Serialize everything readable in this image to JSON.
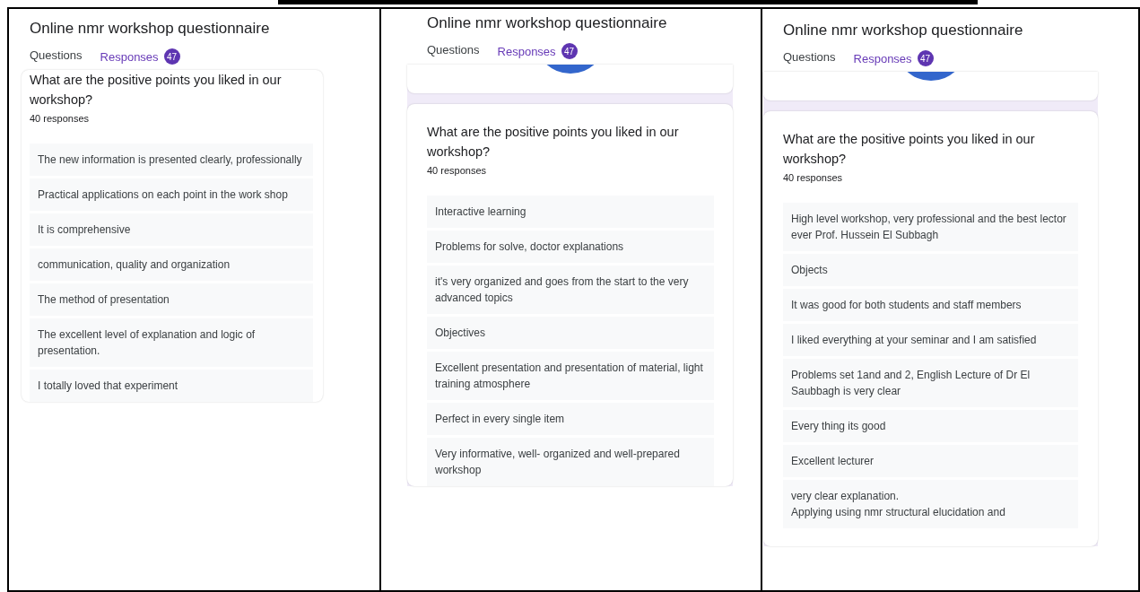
{
  "panels": [
    {
      "title": "Online nmr workshop questionnaire",
      "tabs": [
        {
          "label": "Questions",
          "selected": false
        },
        {
          "label": "Responses",
          "selected": true,
          "badge": "47"
        }
      ],
      "top_card": false,
      "question": "What are the positive points you liked in our workshop?",
      "count": "40 responses",
      "answers": [
        "The new information is presented clearly, professionally",
        "Practical applications on each point in the work shop",
        "It is comprehensive",
        "communication, quality and organization",
        "The method of presentation",
        "The excellent level of explanation and logic of presentation.",
        "I totally loved that experiment"
      ]
    },
    {
      "title": "Online nmr workshop questionnaire",
      "tabs": [
        {
          "label": "Questions",
          "selected": false
        },
        {
          "label": "Responses",
          "selected": true,
          "badge": "47"
        }
      ],
      "top_card": true,
      "question": "What are the positive points you liked in our workshop?",
      "count": "40 responses",
      "answers": [
        "Interactive learning",
        "Problems for solve, doctor explanations",
        "it's very organized and goes from the start to the very advanced topics",
        "Objectives",
        "Excellent presentation and presentation of material, light training atmosphere",
        "Perfect in every single item",
        "Very informative, well- organized and well-prepared workshop"
      ]
    },
    {
      "title": "Online nmr workshop questionnaire",
      "tabs": [
        {
          "label": "Questions",
          "selected": false
        },
        {
          "label": "Responses",
          "selected": true,
          "badge": "47"
        }
      ],
      "top_card": true,
      "question": "What are the positive points you liked in our workshop?",
      "count": "40 responses",
      "answers": [
        "High level workshop, very professional and the best lector ever Prof. Hussein El Subbagh",
        "Objects",
        "It was good for both students and staff members",
        "I liked everything at your seminar and I am satisfied",
        "Problems set 1and and 2, English Lecture of Dr El Saubbagh is very clear",
        "Every thing its good",
        "Excellent lecturer",
        "very clear explanation.\nApplying using nmr structural elucidation and"
      ]
    }
  ]
}
